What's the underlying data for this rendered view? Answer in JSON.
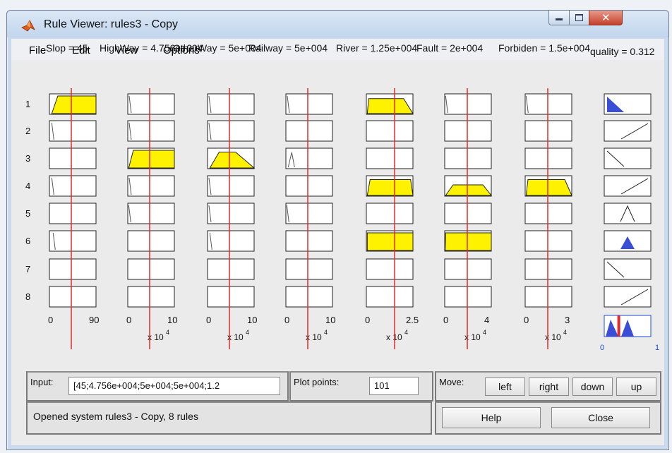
{
  "window": {
    "title": "Rule Viewer: rules3 - Copy"
  },
  "menu": {
    "items": [
      "File",
      "Edit",
      "View",
      "Options"
    ]
  },
  "variables": [
    {
      "label": "Slop = 45",
      "min": "0",
      "max": "90",
      "exp": ""
    },
    {
      "label": "HighWay = 4.756e+004",
      "min": "0",
      "max": "10",
      "exp": "x 10"
    },
    {
      "label": "OtherWay = 5e+004",
      "min": "0",
      "max": "10",
      "exp": "x 10"
    },
    {
      "label": "Railway = 5e+004",
      "min": "0",
      "max": "10",
      "exp": "x 10"
    },
    {
      "label": "River = 1.25e+004",
      "min": "0",
      "max": "2.5",
      "exp": "x 10"
    },
    {
      "label": "Fault = 2e+004",
      "min": "0",
      "max": "4",
      "exp": "x 10"
    },
    {
      "label": "Forbiden = 1.5e+004",
      "min": "0",
      "max": "3",
      "exp": "x 10"
    }
  ],
  "exponent_sup": "4",
  "output": {
    "label": "quality = 0.312",
    "min": "0",
    "max": "1",
    "value": 0.312
  },
  "rule_numbers": [
    "1",
    "2",
    "3",
    "4",
    "5",
    "6",
    "7",
    "8"
  ],
  "input_panel": {
    "label": "Input:",
    "value": "[45;4.756e+004;5e+004;5e+004;1.2"
  },
  "plot_points": {
    "label": "Plot points:",
    "value": "101"
  },
  "move": {
    "label": "Move:",
    "buttons": [
      "left",
      "right",
      "down",
      "up"
    ]
  },
  "status": "Opened system rules3 - Copy, 8 rules",
  "help_label": "Help",
  "close_label": "Close",
  "colors": {
    "fill": "#fff200",
    "indicator": "#e32a2a",
    "output_fill": "#3a4fd6",
    "output_axis": "#1a4dc9"
  }
}
